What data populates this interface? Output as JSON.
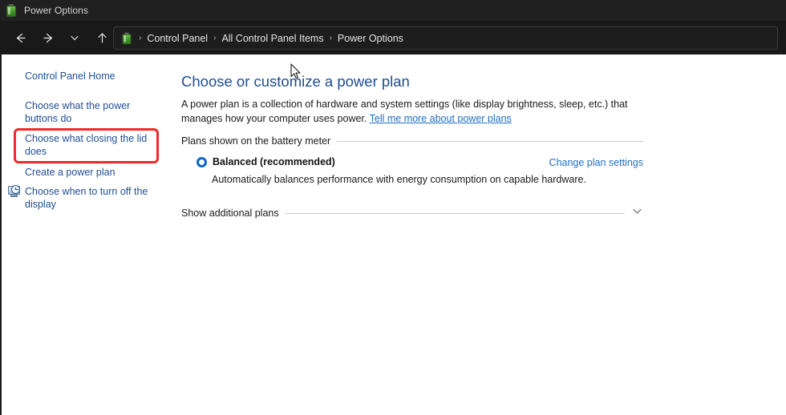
{
  "window": {
    "title": "Power Options",
    "icon": "battery-icon"
  },
  "toolbar": {
    "back_label": "Back",
    "forward_label": "Forward",
    "recent_label": "Recent locations",
    "up_label": "Up",
    "address_icon": "battery-icon",
    "breadcrumb": [
      "Control Panel",
      "All Control Panel Items",
      "Power Options"
    ],
    "separator": "›"
  },
  "sidebar": {
    "items": [
      {
        "label": "Control Panel Home",
        "icon": ""
      },
      {
        "label": "Choose what the power buttons do",
        "icon": ""
      },
      {
        "label": "Choose what closing the lid does",
        "icon": "",
        "highlighted": true
      },
      {
        "label": "Create a power plan",
        "icon": ""
      },
      {
        "label": "Choose when to turn off the display",
        "icon": "display-clock-icon"
      }
    ],
    "highlight_color": "#ee2a2a"
  },
  "content": {
    "page_title": "Choose or customize a power plan",
    "description": "A power plan is a collection of hardware and system settings (like display brightness, sleep, etc.) that manages how your computer uses power.",
    "description_link": "Tell me more about power plans",
    "group_label": "Plans shown on the battery meter",
    "plan": {
      "name": "Balanced (recommended)",
      "selected": true,
      "description": "Automatically balances performance with energy consumption on capable hardware.",
      "settings_link": "Change plan settings"
    },
    "show_additional_label": "Show additional plans",
    "chevron_icon": "chevron-down-icon"
  },
  "colors": {
    "titlebar_bg": "#202020",
    "toolbar_bg": "#191919",
    "accent_link": "#1f6fc4",
    "heading": "#1c4e90",
    "sidebar_link": "#1f4e96",
    "radio_accent": "#0a64c8",
    "highlight": "#ee2a2a"
  }
}
